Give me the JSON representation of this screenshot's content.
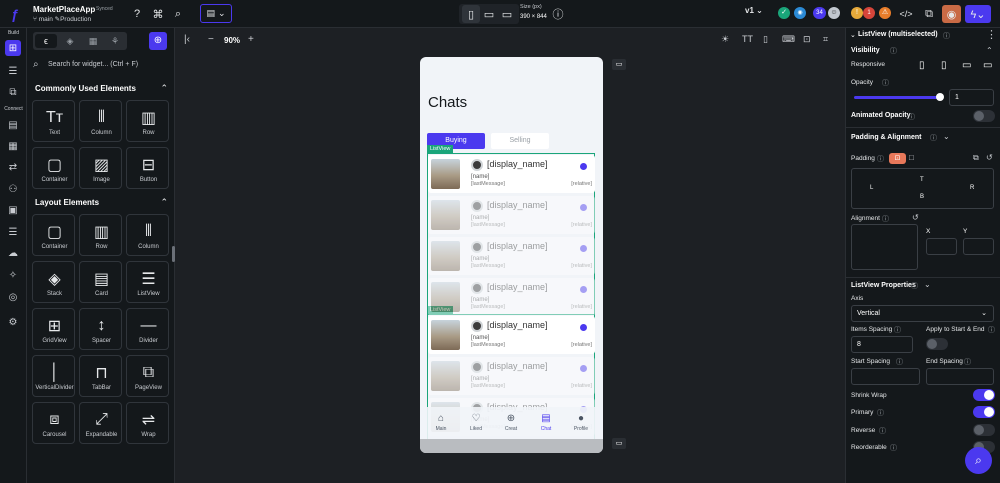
{
  "app": {
    "name": "MarketPlaceApp",
    "sync_status": "Synced",
    "branch": "main",
    "environment": "Production"
  },
  "topbar": {
    "device_size_label": "Size (px)",
    "device_size_value": "390 × 844",
    "version": "v1",
    "badge_count": "34",
    "warning_count": "1"
  },
  "rail": {
    "build_label": "Build",
    "connect_label": "Connect"
  },
  "widgets": {
    "search_placeholder": "Search for widget... (Ctrl + F)",
    "common_title": "Commonly Used Elements",
    "common": [
      {
        "label": "Text",
        "icon": "text-icon"
      },
      {
        "label": "Column",
        "icon": "column-icon"
      },
      {
        "label": "Row",
        "icon": "row-icon"
      },
      {
        "label": "Container",
        "icon": "container-icon"
      },
      {
        "label": "Image",
        "icon": "image-icon"
      },
      {
        "label": "Button",
        "icon": "button-icon"
      }
    ],
    "layout_title": "Layout Elements",
    "layout": [
      {
        "label": "Container",
        "icon": "container-icon"
      },
      {
        "label": "Row",
        "icon": "row-icon"
      },
      {
        "label": "Column",
        "icon": "column-icon"
      },
      {
        "label": "Stack",
        "icon": "stack-icon"
      },
      {
        "label": "Card",
        "icon": "card-icon"
      },
      {
        "label": "ListView",
        "icon": "listview-icon"
      },
      {
        "label": "GridView",
        "icon": "gridview-icon"
      },
      {
        "label": "Spacer",
        "icon": "spacer-icon"
      },
      {
        "label": "Divider",
        "icon": "divider-icon"
      },
      {
        "label": "VerticalDivider",
        "icon": "vertical-divider-icon"
      },
      {
        "label": "TabBar",
        "icon": "tabbar-icon"
      },
      {
        "label": "PageView",
        "icon": "pageview-icon"
      },
      {
        "label": "Carousel",
        "icon": "carousel-icon"
      },
      {
        "label": "Expandable",
        "icon": "expandable-icon"
      },
      {
        "label": "Wrap",
        "icon": "wrap-icon"
      }
    ]
  },
  "canvas": {
    "zoom": "90%"
  },
  "phone": {
    "title": "Chats",
    "tabs": [
      "Buying",
      "Selling"
    ],
    "listview_tag": "ListView",
    "row": {
      "display_name": "[display_name]",
      "name": "[name]",
      "last_message": "[lastMessage]",
      "relative": "[relative]"
    },
    "nav": [
      "Main",
      "Liked",
      "Creat",
      "Chat",
      "Profile"
    ]
  },
  "props": {
    "header": "ListView (multiselected)",
    "visibility": "Visibility",
    "responsive": "Responsive",
    "opacity": "Opacity",
    "opacity_value": "1",
    "opacity_fraction": 1,
    "animated_opacity": "Animated Opacity",
    "padding_alignment": "Padding & Alignment",
    "padding": "Padding",
    "pad_labels": {
      "t": "T",
      "l": "L",
      "r": "R",
      "b": "B"
    },
    "alignment": "Alignment",
    "x_label": "X",
    "y_label": "Y",
    "listview_props": "ListView Properties",
    "axis": "Axis",
    "axis_value": "Vertical",
    "items_spacing": "Items Spacing",
    "items_spacing_value": "8",
    "apply_start_end": "Apply to Start & End",
    "start_spacing": "Start Spacing",
    "end_spacing": "End Spacing",
    "shrink_wrap": "Shrink Wrap",
    "primary": "Primary",
    "reverse": "Reverse",
    "reorderable": "Reorderable"
  },
  "colors": {
    "accent": "#4b39ef",
    "teal": "#1aa57a",
    "bg": "#1d2024"
  }
}
